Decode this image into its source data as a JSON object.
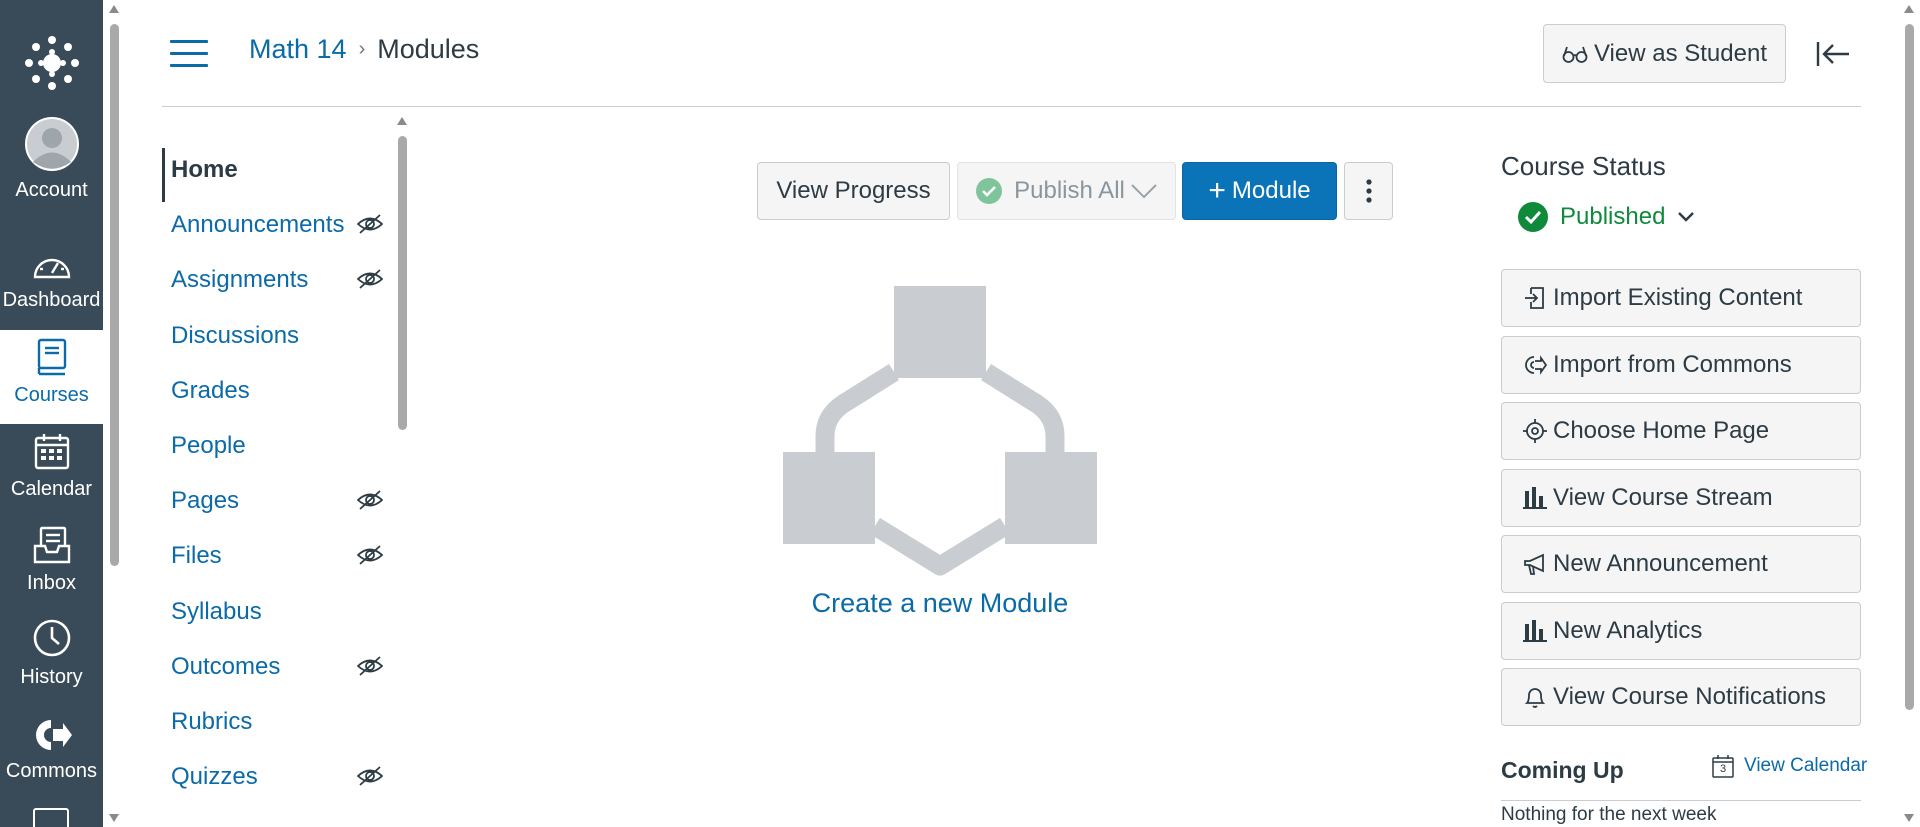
{
  "global_nav": {
    "items": [
      {
        "label": "Account",
        "icon": "avatar-icon"
      },
      {
        "label": "Dashboard",
        "icon": "dashboard-icon"
      },
      {
        "label": "Courses",
        "icon": "courses-icon",
        "active": true
      },
      {
        "label": "Calendar",
        "icon": "calendar-icon"
      },
      {
        "label": "Inbox",
        "icon": "inbox-icon"
      },
      {
        "label": "History",
        "icon": "clock-icon"
      },
      {
        "label": "Commons",
        "icon": "commons-icon"
      }
    ]
  },
  "header": {
    "breadcrumb": {
      "course": "Math 14",
      "page": "Modules"
    },
    "view_as_student": "View as Student"
  },
  "course_nav": {
    "items": [
      {
        "label": "Home",
        "hidden_icon": false,
        "active": true
      },
      {
        "label": "Announcements",
        "hidden_icon": true
      },
      {
        "label": "Assignments",
        "hidden_icon": true
      },
      {
        "label": "Discussions",
        "hidden_icon": false
      },
      {
        "label": "Grades",
        "hidden_icon": false
      },
      {
        "label": "People",
        "hidden_icon": false
      },
      {
        "label": "Pages",
        "hidden_icon": true
      },
      {
        "label": "Files",
        "hidden_icon": true
      },
      {
        "label": "Syllabus",
        "hidden_icon": false
      },
      {
        "label": "Outcomes",
        "hidden_icon": true
      },
      {
        "label": "Rubrics",
        "hidden_icon": false
      },
      {
        "label": "Quizzes",
        "hidden_icon": true
      }
    ]
  },
  "toolbar": {
    "view_progress": "View Progress",
    "publish_all": "Publish All",
    "add_module": "Module",
    "more_icon": "kebab-icon"
  },
  "empty_state": {
    "create_link": "Create a new Module"
  },
  "sidebar": {
    "status_title": "Course Status",
    "status_value": "Published",
    "actions": [
      {
        "label": "Import Existing Content",
        "icon": "import-icon"
      },
      {
        "label": "Import from Commons",
        "icon": "commons-icon"
      },
      {
        "label": "Choose Home Page",
        "icon": "target-icon"
      },
      {
        "label": "View Course Stream",
        "icon": "bar-chart-icon"
      },
      {
        "label": "New Announcement",
        "icon": "megaphone-icon"
      },
      {
        "label": "New Analytics",
        "icon": "bar-chart-icon"
      },
      {
        "label": "View Course Notifications",
        "icon": "bell-icon"
      }
    ],
    "coming_up": "Coming Up",
    "view_calendar": "View Calendar",
    "calendar_icon_day": "3",
    "nothing": "Nothing for the next week"
  },
  "colors": {
    "nav_bg": "#394b58",
    "link": "#0b6aa8",
    "primary": "#0b73b8",
    "success": "#0f8a3b"
  }
}
